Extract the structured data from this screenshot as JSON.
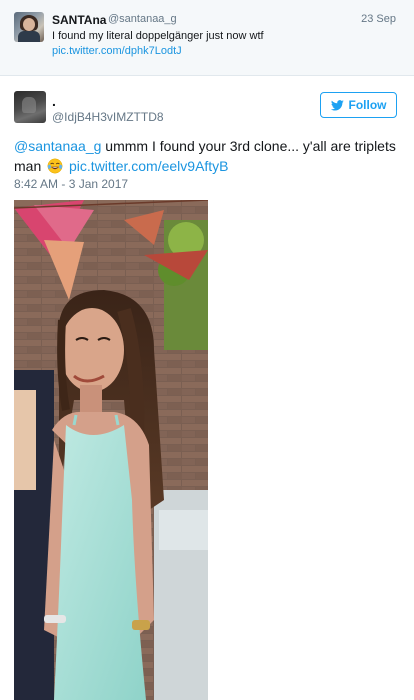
{
  "parent_tweet": {
    "display_name": "SANTAna",
    "handle": "@santanaa_g",
    "date": "23 Sep",
    "text": "I found my literal doppelgänger just now wtf",
    "link": "pic.twitter.com/dphk7LodtJ"
  },
  "main_tweet": {
    "display_name": ".",
    "handle": "@IdjB4H3vIMZTTD8",
    "follow_label": "Follow",
    "mention": "@santanaa_g",
    "text_body": " ummm I found your 3rd clone... y'all are triplets man ",
    "emoji": "face-with-tears-of-joy",
    "link": "pic.twitter.com/eelv9AftyB",
    "timestamp": "8:42 AM - 3 Jan 2017"
  },
  "colors": {
    "link": "#1b95e0",
    "follow": "#1da1f2",
    "muted": "#657786",
    "parent_bg": "#f5f8fa"
  },
  "icons": {
    "follow": "twitter-bird-icon"
  }
}
